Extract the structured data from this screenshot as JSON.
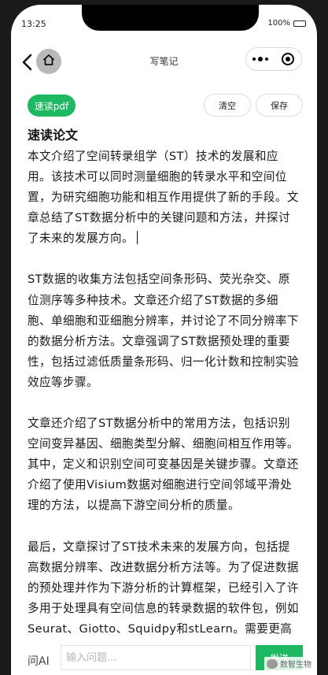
{
  "status_bar": {
    "time": "13:25",
    "battery_text": "100%",
    "battery_level": 1.0
  },
  "nav": {
    "title": "写笔记"
  },
  "toolbar": {
    "pdf_label": "速读pdf",
    "clear_label": "清空",
    "save_label": "保存"
  },
  "document": {
    "title": "速读论文",
    "paragraphs": [
      "本文介绍了空间转录组学（ST）技术的发展和应用。该技术可以同时测量细胞的转录水平和空间位置，为研究细胞功能和相互作用提供了新的手段。文章总结了ST数据分析中的关键问题和方法，并探讨了未来的发展方向。",
      "ST数据的收集方法包括空间条形码、荧光杂交、原位测序等多种技术。文章还介绍了ST数据的多细胞、单细胞和亚细胞分辨率，并讨论了不同分辨率下的数据分析方法。文章强调了ST数据预处理的重要性，包括过滤低质量条形码、归一化计数和控制实验效应等步骤。",
      "文章还介绍了ST数据分析中的常用方法，包括识别空间变异基因、细胞类型分解、细胞间相互作用等。其中，定义和识别空间可变基因是关键步骤。文章还介绍了使用Visium数据对细胞进行空间邻域平滑处理的方法，以提高下游空间分析的质量。",
      "最后，文章探讨了ST技术未来的发展方向，包括提高数据分辨率、改进数据分析方法等。为了促进数据的预处理并作为下游分析的计算框架，已经引入了许多用于处理具有空间信息的转录数据的软件包，例如Seurat、Giotto、Squidpy和stLearn。需要更高级的技术来深入探索预处理阶"
    ]
  },
  "ask": {
    "label": "问AI",
    "placeholder": "输入问题...",
    "send_label": "发送"
  },
  "watermark": {
    "text": "数智生物"
  },
  "colors": {
    "accent": "#1fb862",
    "home_button": "#b9b9b9"
  }
}
